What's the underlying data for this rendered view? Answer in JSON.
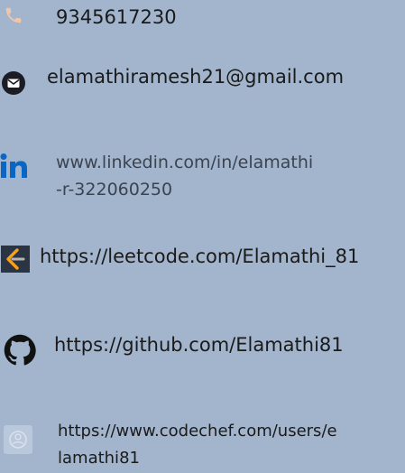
{
  "contacts": {
    "phone": {
      "icon": "phone-icon",
      "text": "9345617230"
    },
    "email": {
      "icon": "email-icon",
      "text": "elamathiramesh21@gmail.com"
    },
    "linkedin": {
      "icon": "linkedin-icon",
      "text": "www.linkedin.com/in/elamathi-r-322060250"
    },
    "leetcode": {
      "icon": "leetcode-icon",
      "text": "https://leetcode.com/Elamathi_81"
    },
    "github": {
      "icon": "github-icon",
      "text": "https://github.com/Elamathi81"
    },
    "codechef": {
      "icon": "codechef-icon",
      "text": "https://www.codechef.com/users/elamathi81"
    }
  },
  "colors": {
    "background": "#a2b5cd",
    "phone_icon": "#f2c5a8",
    "linkedin_blue": "#0a66c2",
    "leetcode_orange": "#f89f1b"
  }
}
